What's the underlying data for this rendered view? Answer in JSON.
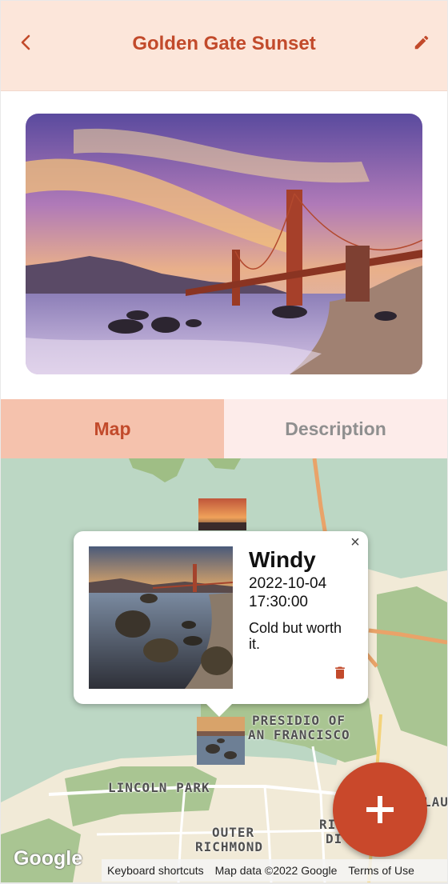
{
  "header": {
    "title": "Golden Gate Sunset",
    "back_icon": "chevron-left-icon",
    "edit_icon": "pencil-icon"
  },
  "tabs": [
    {
      "label": "Map",
      "active": true
    },
    {
      "label": "Description",
      "active": false
    }
  ],
  "map": {
    "labels": {
      "presidio_line1": "PRESIDIO OF",
      "presidio_line2": "AN FRANCISCO",
      "lincoln_park": "LINCOLN PARK",
      "outer_richmond_line1": "OUTER",
      "outer_richmond_line2": "RICHMOND",
      "ri_partial": "RI",
      "di_partial": "DI",
      "lau_partial": "LAU"
    },
    "google_logo": "Google",
    "attribution": {
      "shortcuts": "Keyboard shortcuts",
      "map_data": "Map data ©2022 Google",
      "terms": "Terms of Use"
    }
  },
  "popup": {
    "title": "Windy",
    "date": "2022-10-04 17:30:00",
    "description": "Cold but worth it.",
    "close_label": "×",
    "delete_icon": "trash-icon"
  },
  "fab": {
    "icon": "plus-icon"
  },
  "colors": {
    "accent": "#c24a2b",
    "header_bg": "#fce6da",
    "tab_active_bg": "#f5c2ad",
    "tab_inactive_bg": "#fdecea",
    "fab_bg": "#c9482b"
  }
}
